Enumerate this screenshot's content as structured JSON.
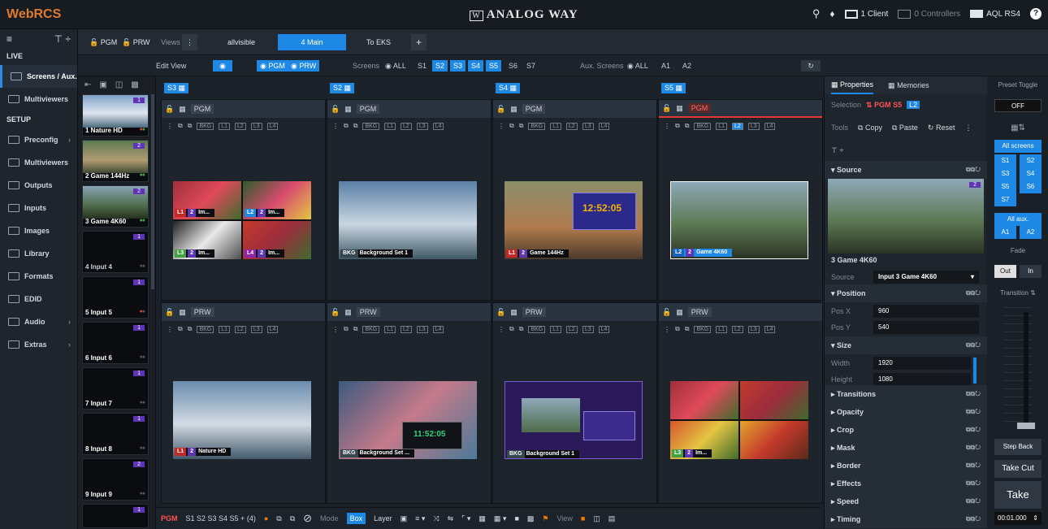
{
  "topbar": {
    "logo": "WebRCS",
    "brand": "ANALOG WAY",
    "clients": "1 Client",
    "controllers": "0 Controllers",
    "device": "AQL RS4",
    "help": "?"
  },
  "sidebar": {
    "live_header": "LIVE",
    "setup_header": "SETUP",
    "items": [
      {
        "label": "Screens / Aux."
      },
      {
        "label": "Multiviewers"
      },
      {
        "label": "Preconfig"
      },
      {
        "label": "Multiviewers"
      },
      {
        "label": "Outputs"
      },
      {
        "label": "Inputs"
      },
      {
        "label": "Images"
      },
      {
        "label": "Library"
      },
      {
        "label": "Formats"
      },
      {
        "label": "EDID"
      },
      {
        "label": "Audio"
      },
      {
        "label": "Extras"
      }
    ]
  },
  "tabs": {
    "pgm": "PGM",
    "prw": "PRW",
    "views": "Views",
    "items": [
      "allvisible",
      "4 Main",
      "To EKS Screens"
    ],
    "add": "+"
  },
  "viewbar": {
    "edit_view": "Edit View",
    "pgm": "PGM",
    "prw": "PRW",
    "screens_label": "Screens",
    "all": "ALL",
    "screens": [
      "S1",
      "S2",
      "S3",
      "S4",
      "S5",
      "S6",
      "S7"
    ],
    "aux_label": "Aux. Screens",
    "aux_all": "ALL",
    "aux": [
      "A1",
      "A2"
    ]
  },
  "sources": [
    {
      "name": "1 Nature HD",
      "num": "1"
    },
    {
      "name": "2 Game 144Hz",
      "num": "2"
    },
    {
      "name": "3 Game 4K60",
      "num": "2"
    },
    {
      "name": "4 Input 4",
      "num": "1"
    },
    {
      "name": "5 Input 5",
      "num": "1"
    },
    {
      "name": "6 Input 6",
      "num": "1"
    },
    {
      "name": "7 Input 7",
      "num": "1"
    },
    {
      "name": "8 Input 8",
      "num": "1"
    },
    {
      "name": "9 Input 9",
      "num": "2"
    },
    {
      "name": "",
      "num": "1"
    }
  ],
  "screens": [
    {
      "id": "S3",
      "pgm": "PGM",
      "prw": "PRW",
      "pgm_tag1": "Im...",
      "pgm_tag2": "Im...",
      "pgm_tag3": "Im...",
      "pgm_tag4": "Im...",
      "prw_tag": "Nature HD"
    },
    {
      "id": "S2",
      "pgm": "PGM",
      "prw": "PRW",
      "pgm_tag1": "Background Set 1",
      "prw_tag": "Background Set ..."
    },
    {
      "id": "S4",
      "pgm": "PGM",
      "prw": "PRW",
      "pgm_tag1": "Game 144Hz",
      "prw_tag": "Background Set 1"
    },
    {
      "id": "S5",
      "pgm": "PGM",
      "prw": "PRW",
      "pgm_tag1": "Game 4K60",
      "prw_tag": "Im..."
    }
  ],
  "clock": "12:52:05",
  "clock2": "11:52:05",
  "layers": [
    "BKG",
    "L1",
    "L2",
    "L3",
    "L4"
  ],
  "properties": {
    "tab_props": "Properties",
    "tab_mem": "Memories",
    "selection": "Selection",
    "sel_val": "PGM S5",
    "sel_layer": "L2",
    "tools": "Tools",
    "copy": "Copy",
    "paste": "Paste",
    "reset": "Reset",
    "source_sec": "Source",
    "source_name": "3 Game 4K60",
    "source_label": "Source",
    "source_value": "Input 3 Game 4K60",
    "position_sec": "Position",
    "pos_x_label": "Pos X",
    "pos_x": "960",
    "pos_y_label": "Pos Y",
    "pos_y": "540",
    "size_sec": "Size",
    "width_label": "Width",
    "width": "1920",
    "height_label": "Height",
    "height": "1080",
    "sections": [
      "Transitions",
      "Opacity",
      "Crop",
      "Mask",
      "Border",
      "Effects",
      "Speed",
      "Timing"
    ]
  },
  "preset": {
    "title": "Preset Toggle",
    "off": "OFF",
    "all_screens": "All screens",
    "screens": [
      "S1",
      "S2",
      "S3",
      "S4",
      "S5",
      "S6",
      "S7"
    ],
    "all_aux": "All aux.",
    "aux": [
      "A1",
      "A2"
    ],
    "fade": "Fade",
    "out": "Out",
    "in": "In",
    "transition": "Transition",
    "step_back": "Step Back",
    "take_cut": "Take Cut",
    "take": "Take",
    "time": "00:01.000"
  },
  "bottombar": {
    "pgm_label": "PGM",
    "pgm_screens": "S1 S2 S3 S4 S5 + (4)",
    "mode": "Mode",
    "box": "Box",
    "layer": "Layer",
    "view": "View"
  }
}
